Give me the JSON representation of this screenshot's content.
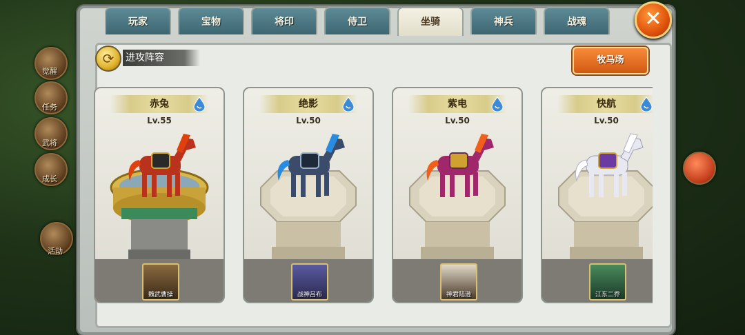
{
  "tabs": [
    {
      "label": "玩家",
      "active": false
    },
    {
      "label": "宝物",
      "active": false
    },
    {
      "label": "将印",
      "active": false
    },
    {
      "label": "侍卫",
      "active": false
    },
    {
      "label": "坐骑",
      "active": true
    },
    {
      "label": "神兵",
      "active": false
    },
    {
      "label": "战魂",
      "active": false
    }
  ],
  "close_label": "✕",
  "lineup_label": "进攻阵容",
  "ranch_label": "牧马场",
  "background": {
    "left_labels": [
      "觉醒",
      "任务",
      "武将",
      "成长",
      "活动"
    ]
  },
  "mounts": [
    {
      "name": "赤兔",
      "level": "Lv.55",
      "hero": "魏武曹操",
      "body_color": "#b8321c",
      "mane_color": "#e0400e",
      "armor_color": "#2a2a2a",
      "pedestal": "ornate-gold"
    },
    {
      "name": "绝影",
      "level": "Lv.50",
      "hero": "战神吕布",
      "body_color": "#3a4c6a",
      "mane_color": "#2a8ce0",
      "armor_color": "#1e2a3a",
      "pedestal": "stone"
    },
    {
      "name": "紫电",
      "level": "Lv.50",
      "hero": "神君陆逊",
      "body_color": "#a0286a",
      "mane_color": "#f0601a",
      "armor_color": "#d0a030",
      "pedestal": "stone"
    },
    {
      "name": "快航",
      "level": "Lv.50",
      "hero": "江东二乔",
      "body_color": "#e8e8f0",
      "mane_color": "#ffffff",
      "armor_color": "#6a3aa0",
      "pedestal": "stone"
    }
  ],
  "colors": {
    "tab_inactive": "#4a7682",
    "tab_active": "#efebd8",
    "close_button": "#e9601a",
    "ranch_button": "#e3702a"
  }
}
